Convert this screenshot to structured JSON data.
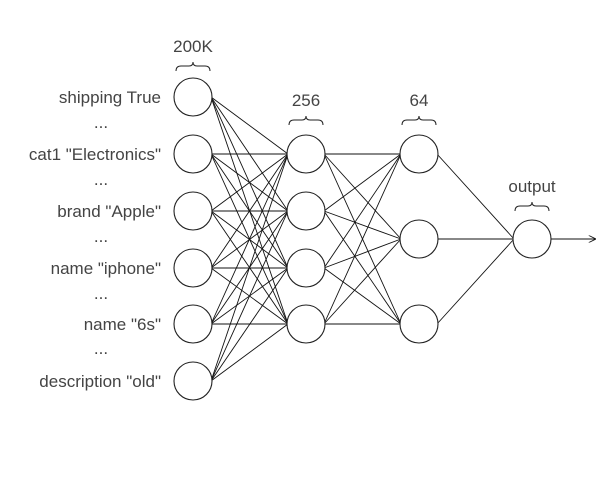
{
  "diagram": {
    "input_labels": [
      "shipping True",
      "...",
      "cat1 \"Electronics\"",
      "...",
      "brand \"Apple\"",
      "...",
      "name \"iphone\"",
      "...",
      "name  \"6s\"",
      "...",
      "description \"old\""
    ],
    "layers": [
      {
        "label": "200K",
        "units": 6
      },
      {
        "label": "256",
        "units": 4
      },
      {
        "label": "64",
        "units": 3
      },
      {
        "label": "output",
        "units": 1
      }
    ],
    "connectivity": "fully-connected",
    "output_arrow": true,
    "colors": {
      "stroke": "#111111",
      "node_fill": "#ffffff",
      "text": "#444444"
    }
  }
}
